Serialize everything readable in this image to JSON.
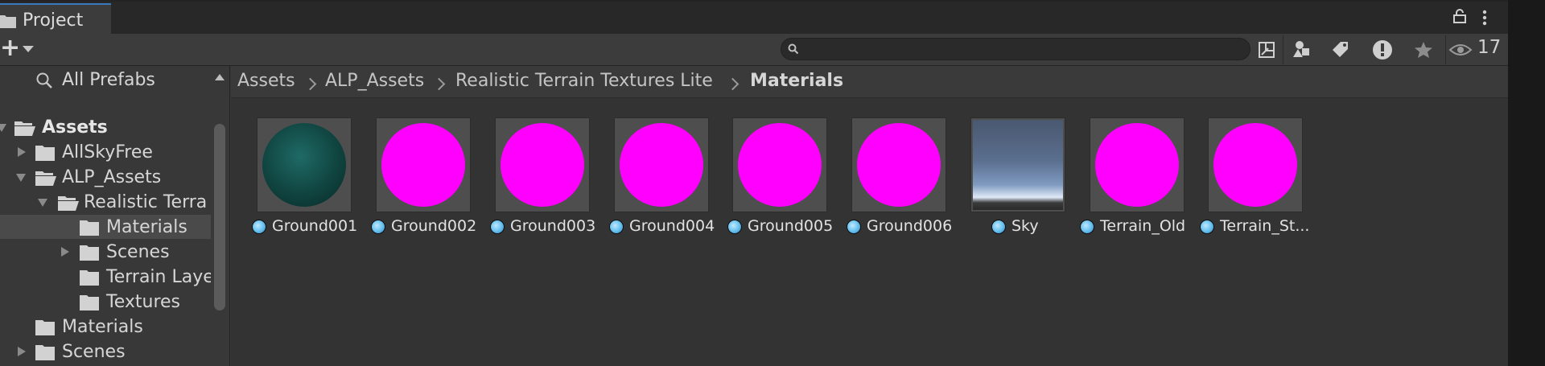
{
  "window": {
    "tab_label": "Project"
  },
  "toolbar": {
    "search_value": "",
    "hidden_count": "17"
  },
  "tree": {
    "items": [
      {
        "label": "All Prefabs"
      },
      {
        "label": "Assets"
      },
      {
        "label": "AllSkyFree"
      },
      {
        "label": "ALP_Assets"
      },
      {
        "label": "Realistic Terra"
      },
      {
        "label": "Materials"
      },
      {
        "label": "Scenes"
      },
      {
        "label": "Terrain Laye"
      },
      {
        "label": "Textures"
      },
      {
        "label": "Materials"
      },
      {
        "label": "Scenes"
      }
    ]
  },
  "breadcrumb": [
    "Assets",
    "ALP_Assets",
    "Realistic Terrain Textures Lite",
    "Materials"
  ],
  "assets": [
    {
      "name": "Ground001"
    },
    {
      "name": "Ground002"
    },
    {
      "name": "Ground003"
    },
    {
      "name": "Ground004"
    },
    {
      "name": "Ground005"
    },
    {
      "name": "Ground006"
    },
    {
      "name": "Sky"
    },
    {
      "name": "Terrain_Old"
    },
    {
      "name": "Terrain_St..."
    }
  ],
  "colors": {
    "missing_shader": "#ff00ff",
    "selection": "#4a4a4a",
    "active_tab_accent": "#3a79bb",
    "material_icon": "#6ac2ef"
  }
}
